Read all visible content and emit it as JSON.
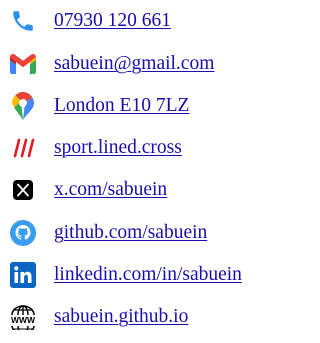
{
  "contacts": [
    {
      "icon": "phone-icon",
      "label": "07930 120 661"
    },
    {
      "icon": "gmail-icon",
      "label": "sabuein@gmail.com"
    },
    {
      "icon": "map-pin-icon",
      "label": "London E10 7LZ"
    },
    {
      "icon": "what3words-icon",
      "label": "sport.lined.cross"
    },
    {
      "icon": "x-icon",
      "label": "x.com/sabuein"
    },
    {
      "icon": "github-icon",
      "label": "github.com/sabuein"
    },
    {
      "icon": "linkedin-icon",
      "label": "linkedin.com/in/sabuein"
    },
    {
      "icon": "www-globe-icon",
      "label": "sabuein.github.io"
    }
  ],
  "colors": {
    "link": "#1a0dab",
    "phone": "#2f8fe8",
    "gmail_red": "#ea4335",
    "gmail_blue": "#4285f4",
    "gmail_green": "#34a853",
    "gmail_yellow": "#fbbc04",
    "what3words_red": "#e11f26",
    "github_blue": "#3b9ded",
    "linkedin_blue": "#0a66c2"
  }
}
